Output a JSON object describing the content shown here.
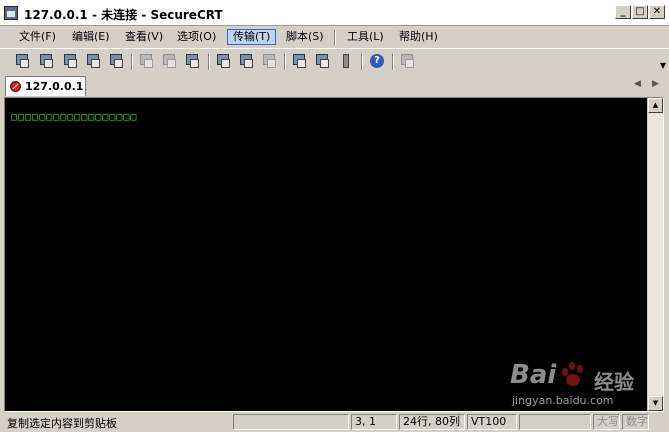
{
  "window": {
    "title": "127.0.0.1 - 未连接 - SecureCRT",
    "minimize_glyph": "_",
    "maximize_glyph": "□",
    "close_glyph": "✕"
  },
  "menu": {
    "items": [
      {
        "label": "文件(F)"
      },
      {
        "label": "编辑(E)"
      },
      {
        "label": "查看(V)"
      },
      {
        "label": "选项(O)"
      },
      {
        "label": "传输(T)",
        "active": true
      },
      {
        "label": "脚本(S)"
      },
      {
        "label": "工具(L)"
      },
      {
        "label": "帮助(H)"
      }
    ]
  },
  "toolbar": {
    "icons": [
      "connect-icon",
      "quick-connect-icon",
      "connect-in-tab-icon",
      "reconnect-icon",
      "disconnect-icon",
      "copy-icon",
      "paste-icon",
      "find-icon",
      "print-icon",
      "print-selection-icon",
      "print-setup-icon",
      "session-options-icon",
      "global-options-icon",
      "keymap-icon",
      "help-icon",
      "sftp-icon"
    ],
    "help_glyph": "?",
    "overflow_glyph": "▼"
  },
  "tabs": {
    "items": [
      {
        "label": "127.0.0.1",
        "status": "disconnected"
      }
    ],
    "prev_glyph": "◀",
    "next_glyph": "▶"
  },
  "terminal": {
    "background": "#000000",
    "text_color": "#3fe03f",
    "line": "□□□□□□□□□□□□□□□□□□"
  },
  "statusbar": {
    "message": "复制选定内容到剪贴板",
    "position": "3,  1",
    "size": "24行, 80列",
    "emulation": "VT100",
    "caps": "大写",
    "num": "数字"
  },
  "watermark": {
    "logo_text": "Bai",
    "logo_suffix": "经验",
    "url": "jingyan.baidu.com"
  },
  "colors": {
    "chrome": "#d4d0c8",
    "active_menu": "#c1d2ee",
    "active_menu_border": "#316ac5"
  }
}
